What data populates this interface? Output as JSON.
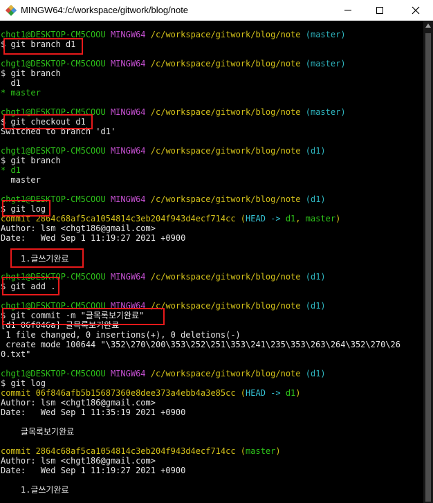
{
  "window": {
    "title": "MINGW64:/c/workspace/gitwork/blog/note",
    "icons": {
      "app": "mingw-diamond-icon",
      "minimize": "minimize-icon",
      "maximize": "maximize-icon",
      "close": "close-icon"
    }
  },
  "colors": {
    "user": "#2ec41a",
    "host": "#c450d0",
    "path": "#d4c21a",
    "branch": "#2fb8c2",
    "annotation": "#e8191a"
  },
  "prompt": {
    "user": "chgt1@DESKTOP-CM5COOU",
    "host": "MINGW64",
    "path": "/c/workspace/gitwork/blog/note",
    "branch_master": "(master)",
    "branch_d1": "(d1)"
  },
  "terminal": {
    "cmd1": "$ git branch d1",
    "cmd2": "$ git branch",
    "out2a": "  d1",
    "out2b": "* master",
    "cmd3": "$ git checkout d1",
    "out3": "Switched to branch 'd1'",
    "cmd4": "$ git branch",
    "out4a": "* d1",
    "out4b": "  master",
    "cmd5": "$ git log",
    "log1_commit_label": "commit ",
    "log1_hash": "2864c68af5ca1054814c3eb204f943d4ecf714cc",
    "log1_ref_open": " (",
    "log1_ref_head": "HEAD -> ",
    "log1_ref_d1": "d1",
    "log1_ref_sep": ", ",
    "log1_ref_master": "master",
    "log1_ref_close": ")",
    "log1_author": "Author: lsm <chgt186@gmail.com>",
    "log1_date": "Date:   Wed Sep 1 11:19:27 2021 +0900",
    "log1_msg": "    1.글쓰기완료",
    "cmd6": "$ git add .",
    "cmd7": "$ git commit -m \"글목록보기완료\"",
    "out7a": "[d1 06f846a] 글목록보기완료",
    "out7b": " 1 file changed, 0 insertions(+), 0 deletions(-)",
    "out7c": " create mode 100644 \"\\352\\270\\200\\353\\252\\251\\353\\241\\235\\353\\263\\264\\352\\270\\26",
    "out7d": "0.txt\"",
    "cmd8": "$ git log",
    "log2_commit_label": "commit ",
    "log2_hash": "06f846afb5b15687360e8dee373a4ebb4a3e85cc",
    "log2_ref_open": " (",
    "log2_ref_head": "HEAD -> ",
    "log2_ref_d1": "d1",
    "log2_ref_close": ")",
    "log2_author": "Author: lsm <chgt186@gmail.com>",
    "log2_date": "Date:   Wed Sep 1 11:35:19 2021 +0900",
    "log2_msg": "    글목록보기완료",
    "log3_commit_label": "commit ",
    "log3_hash": "2864c68af5ca1054814c3eb204f943d4ecf714cc",
    "log3_ref_open": " (",
    "log3_ref_master": "master",
    "log3_ref_close": ")",
    "log3_author": "Author: lsm <chgt186@gmail.com>",
    "log3_date": "Date:   Wed Sep 1 11:19:27 2021 +0900",
    "log3_msg": "    1.글쓰기완료"
  }
}
